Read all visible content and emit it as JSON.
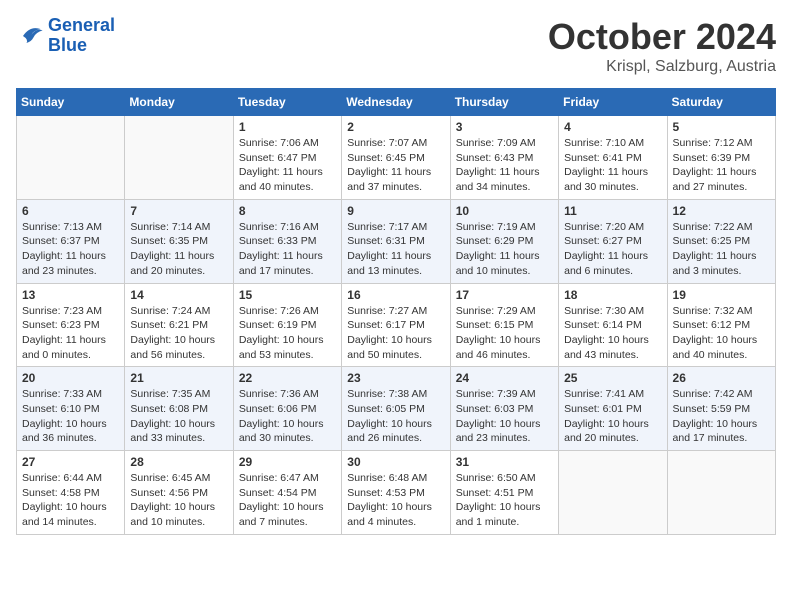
{
  "header": {
    "logo_line1": "General",
    "logo_line2": "Blue",
    "month": "October 2024",
    "location": "Krispl, Salzburg, Austria"
  },
  "weekdays": [
    "Sunday",
    "Monday",
    "Tuesday",
    "Wednesday",
    "Thursday",
    "Friday",
    "Saturday"
  ],
  "weeks": [
    [
      {
        "day": "",
        "info": ""
      },
      {
        "day": "",
        "info": ""
      },
      {
        "day": "1",
        "info": "Sunrise: 7:06 AM\nSunset: 6:47 PM\nDaylight: 11 hours and 40 minutes."
      },
      {
        "day": "2",
        "info": "Sunrise: 7:07 AM\nSunset: 6:45 PM\nDaylight: 11 hours and 37 minutes."
      },
      {
        "day": "3",
        "info": "Sunrise: 7:09 AM\nSunset: 6:43 PM\nDaylight: 11 hours and 34 minutes."
      },
      {
        "day": "4",
        "info": "Sunrise: 7:10 AM\nSunset: 6:41 PM\nDaylight: 11 hours and 30 minutes."
      },
      {
        "day": "5",
        "info": "Sunrise: 7:12 AM\nSunset: 6:39 PM\nDaylight: 11 hours and 27 minutes."
      }
    ],
    [
      {
        "day": "6",
        "info": "Sunrise: 7:13 AM\nSunset: 6:37 PM\nDaylight: 11 hours and 23 minutes."
      },
      {
        "day": "7",
        "info": "Sunrise: 7:14 AM\nSunset: 6:35 PM\nDaylight: 11 hours and 20 minutes."
      },
      {
        "day": "8",
        "info": "Sunrise: 7:16 AM\nSunset: 6:33 PM\nDaylight: 11 hours and 17 minutes."
      },
      {
        "day": "9",
        "info": "Sunrise: 7:17 AM\nSunset: 6:31 PM\nDaylight: 11 hours and 13 minutes."
      },
      {
        "day": "10",
        "info": "Sunrise: 7:19 AM\nSunset: 6:29 PM\nDaylight: 11 hours and 10 minutes."
      },
      {
        "day": "11",
        "info": "Sunrise: 7:20 AM\nSunset: 6:27 PM\nDaylight: 11 hours and 6 minutes."
      },
      {
        "day": "12",
        "info": "Sunrise: 7:22 AM\nSunset: 6:25 PM\nDaylight: 11 hours and 3 minutes."
      }
    ],
    [
      {
        "day": "13",
        "info": "Sunrise: 7:23 AM\nSunset: 6:23 PM\nDaylight: 11 hours and 0 minutes."
      },
      {
        "day": "14",
        "info": "Sunrise: 7:24 AM\nSunset: 6:21 PM\nDaylight: 10 hours and 56 minutes."
      },
      {
        "day": "15",
        "info": "Sunrise: 7:26 AM\nSunset: 6:19 PM\nDaylight: 10 hours and 53 minutes."
      },
      {
        "day": "16",
        "info": "Sunrise: 7:27 AM\nSunset: 6:17 PM\nDaylight: 10 hours and 50 minutes."
      },
      {
        "day": "17",
        "info": "Sunrise: 7:29 AM\nSunset: 6:15 PM\nDaylight: 10 hours and 46 minutes."
      },
      {
        "day": "18",
        "info": "Sunrise: 7:30 AM\nSunset: 6:14 PM\nDaylight: 10 hours and 43 minutes."
      },
      {
        "day": "19",
        "info": "Sunrise: 7:32 AM\nSunset: 6:12 PM\nDaylight: 10 hours and 40 minutes."
      }
    ],
    [
      {
        "day": "20",
        "info": "Sunrise: 7:33 AM\nSunset: 6:10 PM\nDaylight: 10 hours and 36 minutes."
      },
      {
        "day": "21",
        "info": "Sunrise: 7:35 AM\nSunset: 6:08 PM\nDaylight: 10 hours and 33 minutes."
      },
      {
        "day": "22",
        "info": "Sunrise: 7:36 AM\nSunset: 6:06 PM\nDaylight: 10 hours and 30 minutes."
      },
      {
        "day": "23",
        "info": "Sunrise: 7:38 AM\nSunset: 6:05 PM\nDaylight: 10 hours and 26 minutes."
      },
      {
        "day": "24",
        "info": "Sunrise: 7:39 AM\nSunset: 6:03 PM\nDaylight: 10 hours and 23 minutes."
      },
      {
        "day": "25",
        "info": "Sunrise: 7:41 AM\nSunset: 6:01 PM\nDaylight: 10 hours and 20 minutes."
      },
      {
        "day": "26",
        "info": "Sunrise: 7:42 AM\nSunset: 5:59 PM\nDaylight: 10 hours and 17 minutes."
      }
    ],
    [
      {
        "day": "27",
        "info": "Sunrise: 6:44 AM\nSunset: 4:58 PM\nDaylight: 10 hours and 14 minutes."
      },
      {
        "day": "28",
        "info": "Sunrise: 6:45 AM\nSunset: 4:56 PM\nDaylight: 10 hours and 10 minutes."
      },
      {
        "day": "29",
        "info": "Sunrise: 6:47 AM\nSunset: 4:54 PM\nDaylight: 10 hours and 7 minutes."
      },
      {
        "day": "30",
        "info": "Sunrise: 6:48 AM\nSunset: 4:53 PM\nDaylight: 10 hours and 4 minutes."
      },
      {
        "day": "31",
        "info": "Sunrise: 6:50 AM\nSunset: 4:51 PM\nDaylight: 10 hours and 1 minute."
      },
      {
        "day": "",
        "info": ""
      },
      {
        "day": "",
        "info": ""
      }
    ]
  ]
}
